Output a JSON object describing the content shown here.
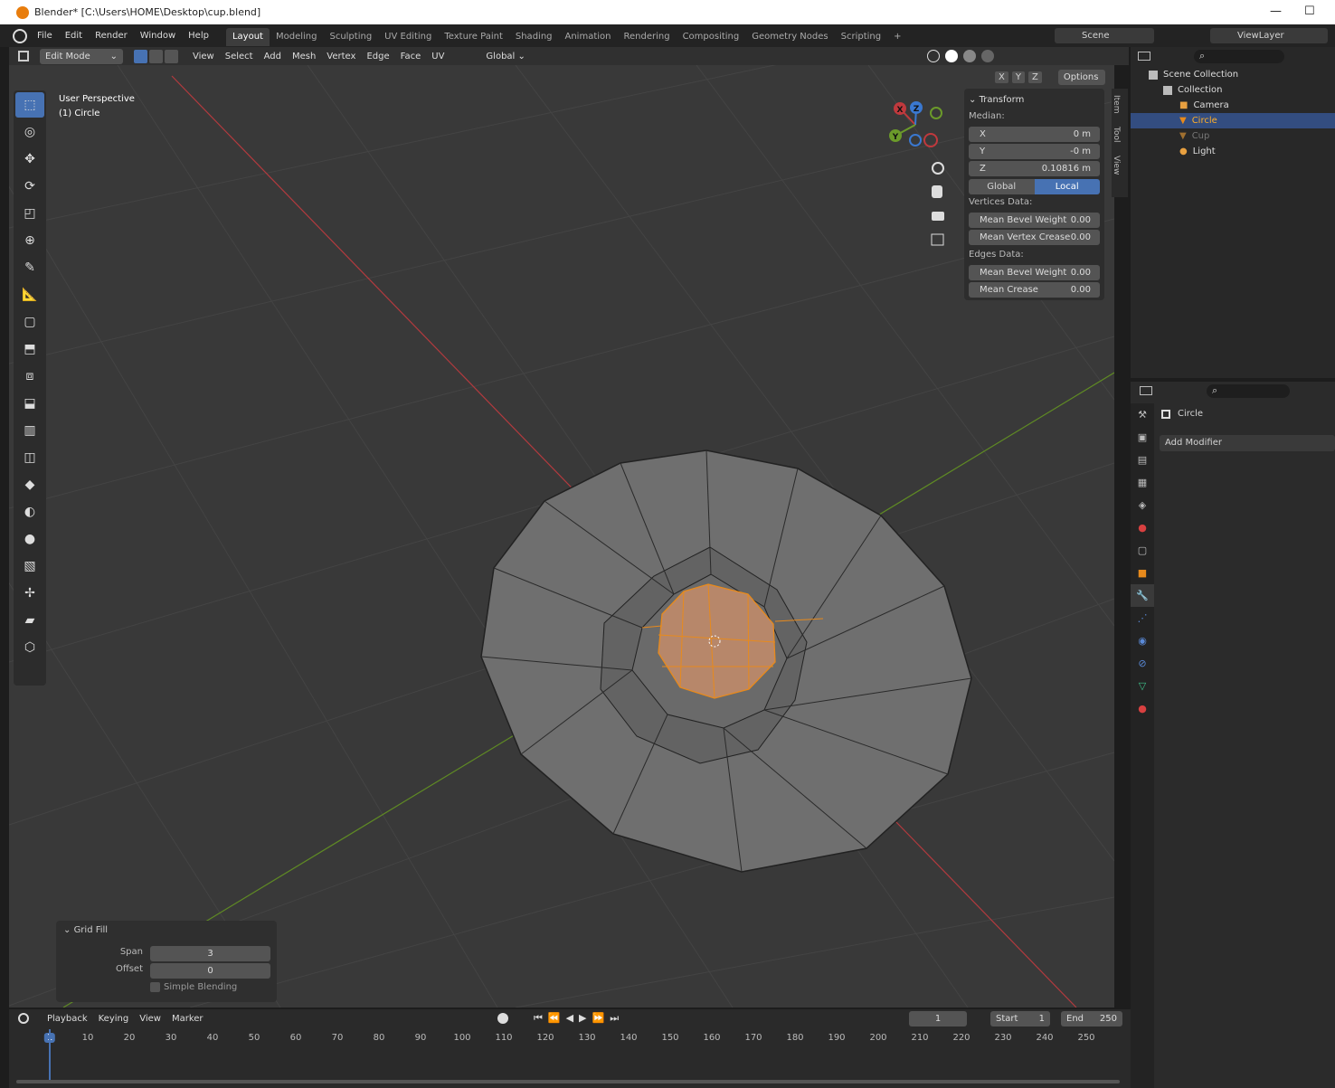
{
  "title": "Blender* [C:\\Users\\HOME\\Desktop\\cup.blend]",
  "window_controls": {
    "minimize": "—",
    "maximize": "☐"
  },
  "menus": [
    "File",
    "Edit",
    "Render",
    "Window",
    "Help"
  ],
  "workspaces": [
    "Layout",
    "Modeling",
    "Sculpting",
    "UV Editing",
    "Texture Paint",
    "Shading",
    "Animation",
    "Rendering",
    "Compositing",
    "Geometry Nodes",
    "Scripting"
  ],
  "workspace_add": "+",
  "scene": "Scene",
  "view_layer": "ViewLayer",
  "header": {
    "mode": "Edit Mode",
    "menus": [
      "View",
      "Select",
      "Add",
      "Mesh",
      "Vertex",
      "Edge",
      "Face",
      "UV"
    ],
    "orientation": "Global",
    "axes": [
      "X",
      "Y",
      "Z"
    ],
    "options": "Options"
  },
  "viewport": {
    "perspective": "User Perspective",
    "object": "(1) Circle"
  },
  "gizmo": {
    "x": "X",
    "y": "Y",
    "z": "Z"
  },
  "npanel": {
    "title": "Transform",
    "median": "Median:",
    "x_label": "X",
    "x_value": "0 m",
    "y_label": "Y",
    "y_value": "-0 m",
    "z_label": "Z",
    "z_value": "0.10816 m",
    "global": "Global",
    "local": "Local",
    "vertices_data": "Vertices Data:",
    "mean_bevel_weight": "Mean Bevel Weight",
    "mean_bevel_weight_value": "0.00",
    "mean_vertex_crease": "Mean Vertex Crease",
    "mean_vertex_crease_value": "0.00",
    "edges_data": "Edges Data:",
    "edge_bevel_weight": "Mean Bevel Weight",
    "edge_bevel_weight_value": "0.00",
    "mean_crease": "Mean Crease",
    "mean_crease_value": "0.00",
    "tabs": [
      "Item",
      "Tool",
      "View"
    ]
  },
  "outliner": {
    "scene_collection": "Scene Collection",
    "collection": "Collection",
    "items": [
      "Camera",
      "Circle",
      "Cup",
      "Light"
    ]
  },
  "properties": {
    "object": "Circle",
    "add_modifier": "Add Modifier"
  },
  "gridfill": {
    "title": "Grid Fill",
    "span_label": "Span",
    "span_value": "3",
    "offset_label": "Offset",
    "offset_value": "0",
    "simple_blending": "Simple Blending"
  },
  "timeline": {
    "menus": [
      "Playback",
      "Keying",
      "View",
      "Marker"
    ],
    "current_frame": "1",
    "start_label": "Start",
    "start_value": "1",
    "end_label": "End",
    "end_value": "250",
    "ticks": [
      "1",
      "10",
      "20",
      "30",
      "40",
      "50",
      "60",
      "70",
      "80",
      "90",
      "100",
      "110",
      "120",
      "130",
      "140",
      "150",
      "160",
      "170",
      "180",
      "190",
      "200",
      "210",
      "220",
      "230",
      "240",
      "250"
    ]
  },
  "colors": {
    "accent": "#4772b3",
    "selection": "#e88a1c",
    "x_axis": "#c0393d",
    "y_axis": "#6b9a2a"
  }
}
